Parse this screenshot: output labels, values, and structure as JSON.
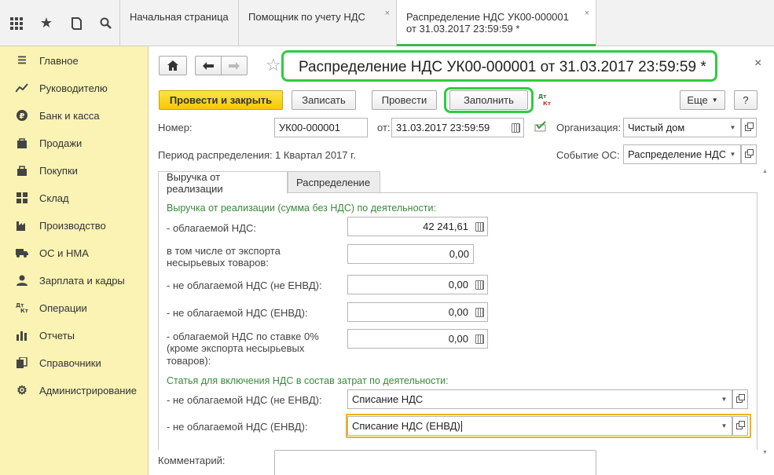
{
  "topbar": {
    "icons": [
      "apps-grid-icon",
      "star-icon",
      "history-icon",
      "search-icon"
    ],
    "tabs": [
      {
        "label": "Начальная страница"
      },
      {
        "label": "Помощник по учету НДС"
      },
      {
        "label_line1": "Распределение НДС УК00-000001",
        "label_line2": "от 31.03.2017 23:59:59 *"
      }
    ]
  },
  "sidebar": {
    "items": [
      {
        "label": "Главное",
        "icon": "menu-icon"
      },
      {
        "label": "Руководителю",
        "icon": "trend-icon"
      },
      {
        "label": "Банк и касса",
        "icon": "ruble-icon"
      },
      {
        "label": "Продажи",
        "icon": "cart-icon"
      },
      {
        "label": "Покупки",
        "icon": "basket-icon"
      },
      {
        "label": "Склад",
        "icon": "warehouse-icon"
      },
      {
        "label": "Производство",
        "icon": "factory-icon"
      },
      {
        "label": "ОС и НМА",
        "icon": "truck-icon"
      },
      {
        "label": "Зарплата и кадры",
        "icon": "people-icon"
      },
      {
        "label": "Операции",
        "icon": "dt-kt-icon"
      },
      {
        "label": "Отчеты",
        "icon": "bar-chart-icon"
      },
      {
        "label": "Справочники",
        "icon": "books-icon"
      },
      {
        "label": "Администрирование",
        "icon": "gear-icon"
      }
    ]
  },
  "document": {
    "title": "Распределение НДС УК00-000001 от 31.03.2017 23:59:59 *",
    "toolbar": {
      "post_close": "Провести и закрыть",
      "write": "Записать",
      "post": "Провести",
      "fill": "Заполнить",
      "more": "Еще",
      "help": "?"
    },
    "number_label": "Номер:",
    "number_value": "УК00-000001",
    "date_label": "от:",
    "date_value": "31.03.2017 23:59:59",
    "org_label": "Организация:",
    "org_value": "Чистый дом",
    "period_label": "Период распределения:",
    "period_value": "1 Квартал 2017  г.",
    "event_label": "Событие ОС:",
    "event_value": "Распределение НДС",
    "tabs": [
      "Выручка от реализации",
      "Распределение"
    ],
    "revenue_heading": "Выручка от реализации (сумма без НДС) по деятельности:",
    "rows": [
      {
        "label": "- облагаемой НДС:",
        "value": "42 241,61"
      },
      {
        "label_line1": "в том числе от экспорта",
        "label_line2": "несырьевых товаров:",
        "value": "0,00"
      },
      {
        "label": "- не облагаемой НДС (не ЕНВД):",
        "value": "0,00"
      },
      {
        "label": "- не облагаемой НДС (ЕНВД):",
        "value": "0,00"
      },
      {
        "label_line1": "- облагаемой НДС по ставке 0%",
        "label_line2": "(кроме экспорта несырьевых",
        "label_line3": "товаров):",
        "value": "0,00"
      }
    ],
    "cost_heading": "Статья для включения НДС в состав затрат по деятельности:",
    "cost_rows": [
      {
        "label": "- не облагаемой НДС (не ЕНВД):",
        "value": "Списание НДС"
      },
      {
        "label": "- не облагаемой НДС (ЕНВД):",
        "value": "Списание НДС (ЕНВД)"
      }
    ],
    "comment_label": "Комментарий:"
  },
  "colors": {
    "highlight": "#2ecc40",
    "primary_button": "#f4c800",
    "sidebar_bg": "#faf3b4",
    "heading_green": "#3a8a3a",
    "focus_border": "#f0b400"
  }
}
